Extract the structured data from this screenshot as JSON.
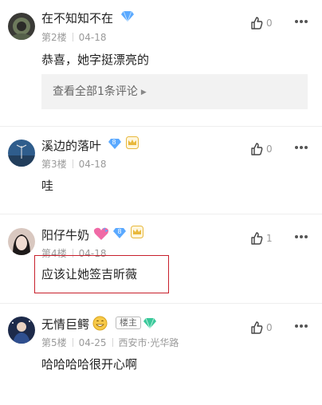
{
  "comments": [
    {
      "username": "在不知知不在",
      "floor": "第2楼",
      "date": "04-18",
      "content": "恭喜，她字挺漂亮的",
      "likes": "0",
      "replies_link": "查看全部1条评论"
    },
    {
      "username": "溪边的落叶",
      "floor": "第3楼",
      "date": "04-18",
      "content": "哇",
      "likes": "0",
      "level_badge": "8"
    },
    {
      "username": "阳仔牛奶",
      "floor": "第4楼",
      "date": "04-18",
      "content": "应该让她签吉昕薇",
      "likes": "1",
      "level_badge": "8"
    },
    {
      "username": "无情巨鳄",
      "owner_tag": "楼主",
      "floor": "第5楼",
      "date": "04-25",
      "location": "西安市·光华路",
      "content": "哈哈哈哈很开心啊",
      "likes": "0"
    }
  ],
  "colors": {
    "highlight_border": "#c8202c",
    "meta_text": "#9a9a9a",
    "diamond_blue": "#5aa9ff",
    "diamond_green": "#39c89a",
    "badge_blue": "#6fa8f0",
    "crown_gold": "#e8b83c"
  }
}
